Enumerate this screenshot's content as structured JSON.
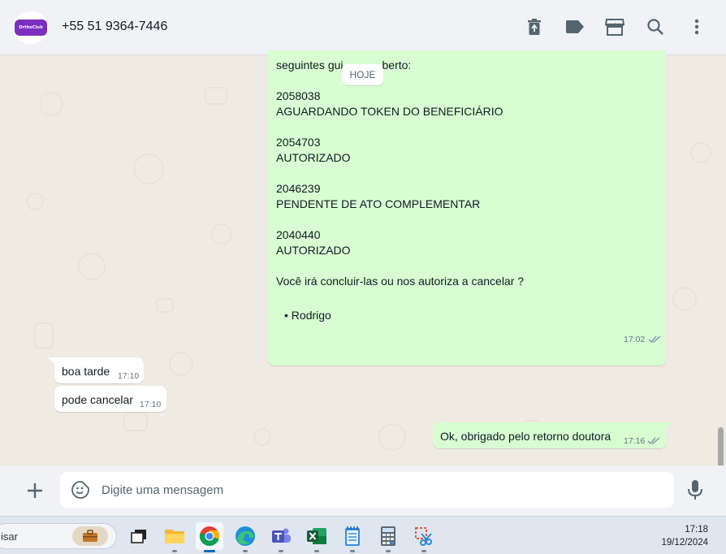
{
  "header": {
    "logo_text": "OrthoClub",
    "contact": "+55 51 9364-7446",
    "icons": [
      "trash-icon",
      "label-icon",
      "store-icon",
      "search-icon",
      "menu-icon"
    ]
  },
  "date_chip": "HOJE",
  "messages": {
    "big": {
      "lines": [
        "seguintes gui",
        "berto:",
        "2058038",
        "AGUARDANDO TOKEN DO BENEFICIÁRIO",
        "2054703",
        "AUTORIZADO",
        "2046239",
        "PENDENTE DE ATO COMPLEMENTAR",
        "2040440",
        "AUTORIZADO",
        "Você irá concluir-las ou nos autoriza a cancelar ?",
        "• Rodrigo"
      ],
      "time": "17:02"
    },
    "in1": {
      "text": "boa tarde",
      "time": "17:10"
    },
    "in2": {
      "text": "pode cancelar",
      "time": "17:10"
    },
    "out1": {
      "text": "Ok, obrigado pelo retorno doutora",
      "time": "17:16"
    }
  },
  "composer": {
    "placeholder": "Digite uma mensagem"
  },
  "taskbar": {
    "search_text": "isar",
    "time": "17:18",
    "date": "19/12/2024",
    "apps": [
      "task-view",
      "file-explorer",
      "chrome",
      "edge",
      "teams",
      "excel",
      "notepad",
      "calculator",
      "snipping-tool"
    ]
  },
  "colors": {
    "outgoing_bubble": "#d9fdd3",
    "incoming_bubble": "#ffffff",
    "chat_bg": "#efeae2",
    "header_bg": "#f0f2f5",
    "tick_color": "#53bdeb"
  }
}
